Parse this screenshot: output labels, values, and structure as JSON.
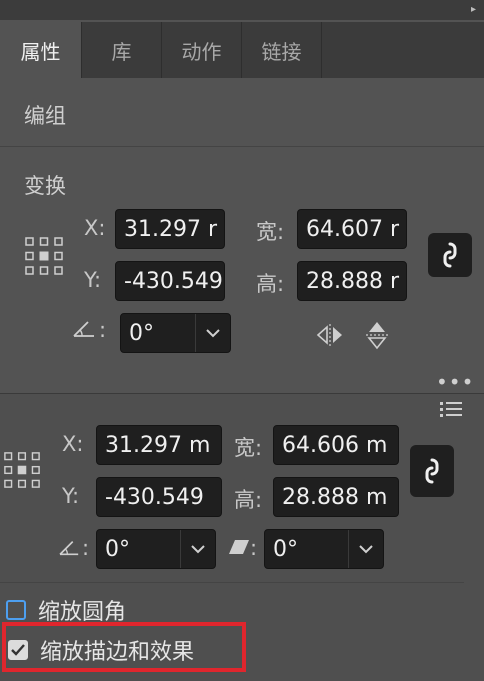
{
  "tabs": [
    "属性",
    "库",
    "动作",
    "链接"
  ],
  "active_tab": "属性",
  "sections": {
    "group": "编组",
    "transform": "变换"
  },
  "transform_upper": {
    "x_label": "X:",
    "x_value": "31.297 r",
    "y_label": "Y:",
    "y_value": "-430.549",
    "w_label": "宽:",
    "w_value": "64.607 r",
    "h_label": "高:",
    "h_value": "28.888 r",
    "angle_label": ":",
    "angle_value": "0°"
  },
  "transform_lower": {
    "x_label": "X:",
    "x_value": "31.297 m",
    "y_label": "Y:",
    "y_value": "-430.549",
    "w_label": "宽:",
    "w_value": "64.606 m",
    "h_label": "高:",
    "h_value": "28.888 m",
    "angle_label": ":",
    "angle_value": "0°",
    "shear_label": ":",
    "shear_value": "0°"
  },
  "options": {
    "scale_corners": {
      "label": "缩放圆角",
      "checked": false
    },
    "scale_strokes": {
      "label": "缩放描边和效果",
      "checked": true
    }
  },
  "colors": {
    "checkbox_accent": "#4d9ff0",
    "highlight": "#e0262d",
    "panel_bg": "#535353"
  }
}
